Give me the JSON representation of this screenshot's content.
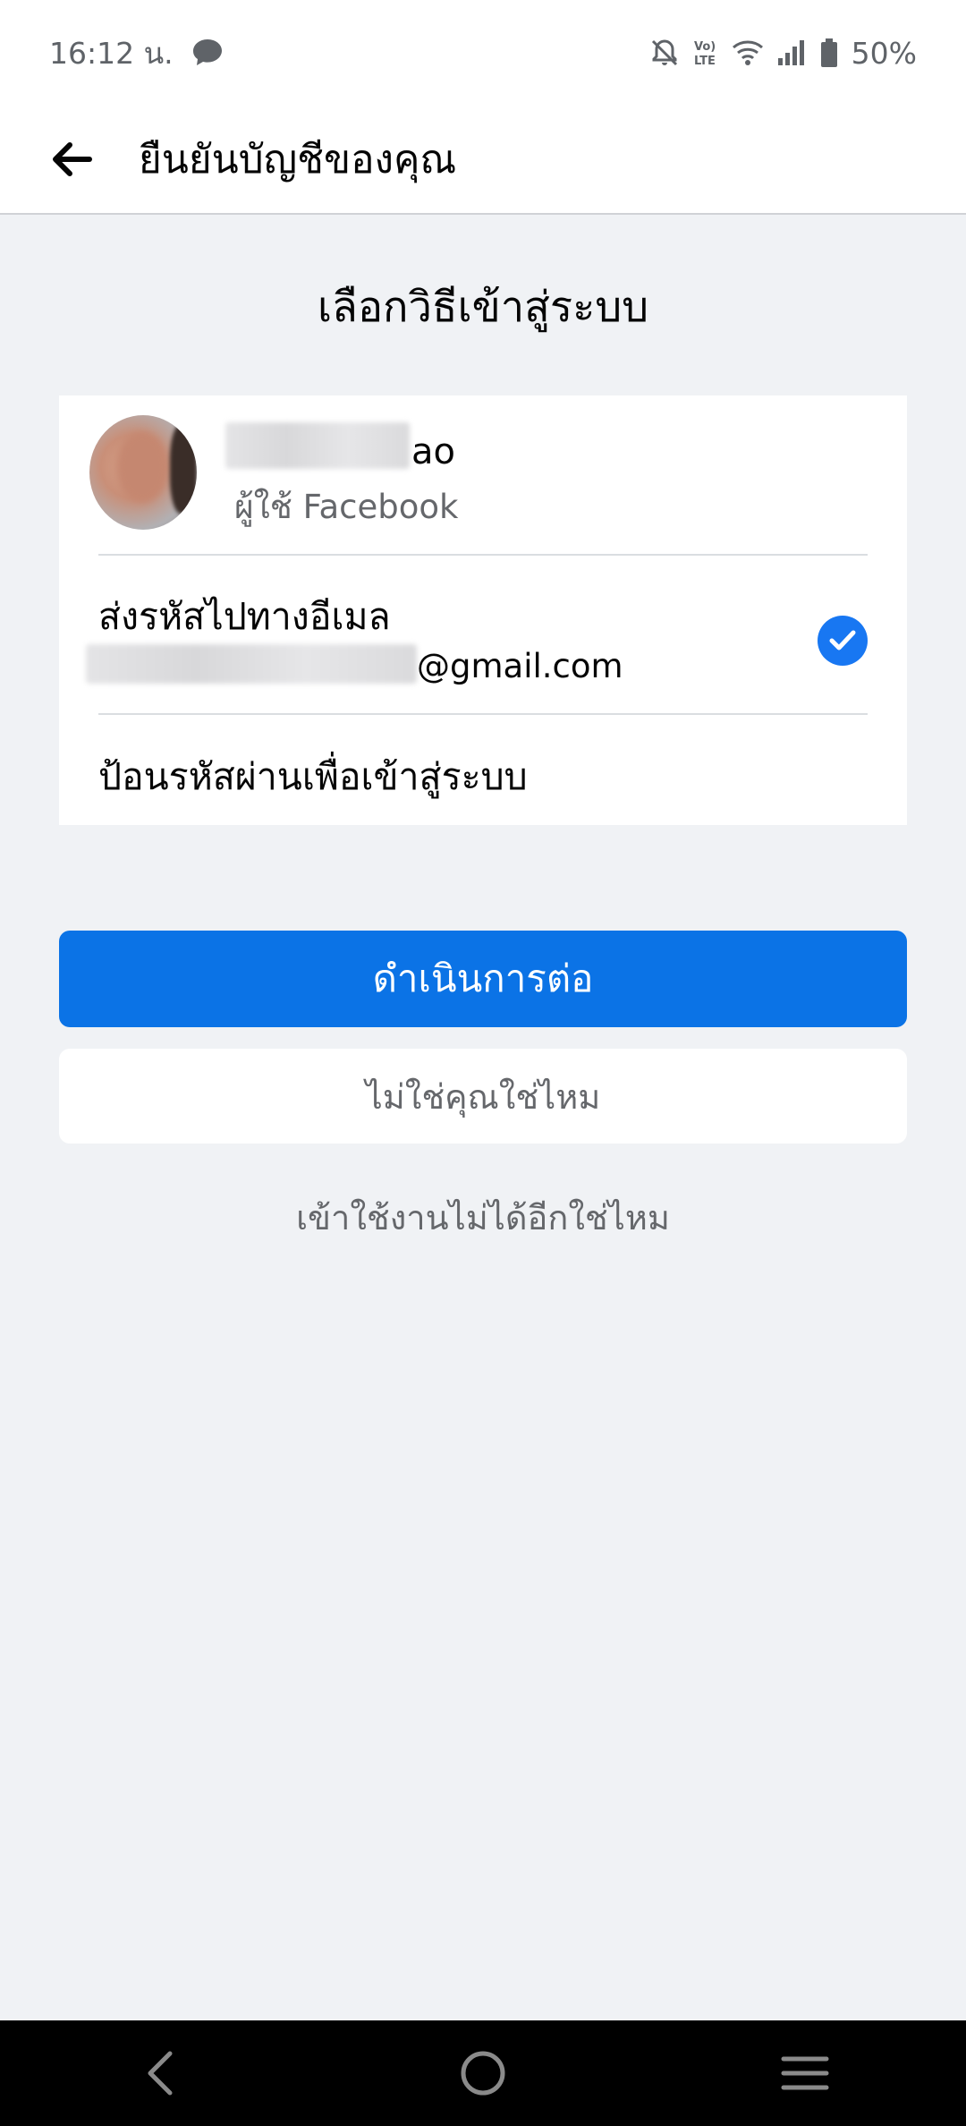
{
  "status_bar": {
    "time": "16:12 น.",
    "battery": "50%",
    "icons": [
      "chat-bubble-icon",
      "bell-off-icon",
      "volte-icon",
      "wifi-icon",
      "signal-icon",
      "battery-icon"
    ]
  },
  "app_bar": {
    "back_icon": "arrow-left-icon",
    "title": "ยืนยันบัญชีของคุณ"
  },
  "main": {
    "heading": "เลือกวิธีเข้าสู่ระบบ",
    "account": {
      "name_visible_suffix": "ao",
      "subtitle": "ผู้ใช้ Facebook"
    },
    "options": [
      {
        "title": "ส่งรหัสไปทางอีเมล",
        "detail_visible_suffix": "@gmail.com",
        "selected": true
      },
      {
        "title": "ป้อนรหัสผ่านเพื่อเข้าสู่ระบบ",
        "selected": false
      }
    ],
    "continue_button": "ดำเนินการต่อ",
    "not_you_button": "ไม่ใช่คุณใช่ไหม",
    "cant_access_link": "เข้าใช้งานไม่ได้อีกใช่ไหม"
  },
  "colors": {
    "primary": "#0b73e6",
    "check": "#1877f2",
    "background": "#f0f2f5",
    "secondary_text": "#65676b"
  },
  "nav_bar": {
    "icons": [
      "nav-back-icon",
      "nav-home-icon",
      "nav-menu-icon"
    ]
  }
}
